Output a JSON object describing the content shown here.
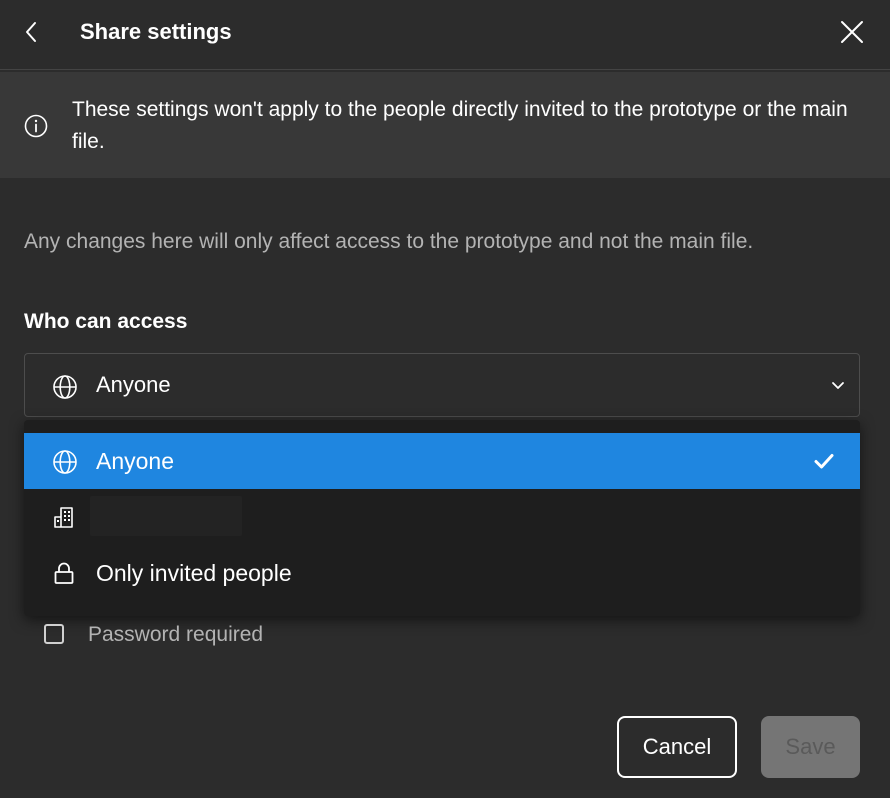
{
  "header": {
    "title": "Share settings",
    "back_icon": "chevron-left-icon",
    "close_icon": "close-icon"
  },
  "notice": {
    "icon": "info-icon",
    "text": "These settings won't apply to the people directly invited to the prototype or the main file."
  },
  "description": "Any changes here will only affect access to the prototype and not the main file.",
  "access": {
    "label": "Who can access",
    "selected": "Anyone",
    "options": [
      {
        "label": "Anyone",
        "icon": "globe-icon",
        "selected": true
      },
      {
        "label": "",
        "icon": "building-icon",
        "selected": false
      },
      {
        "label": "Only invited people",
        "icon": "lock-icon",
        "selected": false
      }
    ]
  },
  "password": {
    "label": "Password required",
    "checked": false
  },
  "footer": {
    "cancel_label": "Cancel",
    "save_label": "Save"
  },
  "colors": {
    "background": "#2c2c2c",
    "notice_background": "#383838",
    "dropdown_background": "#1e1e1e",
    "selected_option": "#1f86e0",
    "save_disabled": "#757575"
  }
}
